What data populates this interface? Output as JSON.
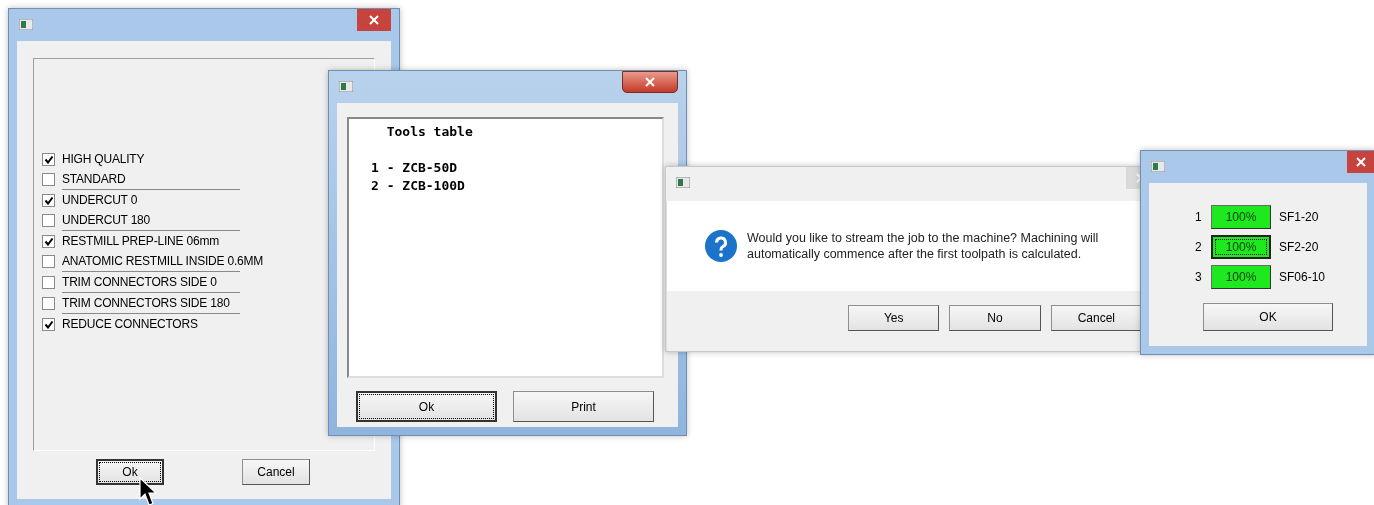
{
  "windows": [
    {
      "kind": "options",
      "items": [
        {
          "kind": "checkbox",
          "label": "HIGH QUALITY",
          "checked": true
        },
        {
          "kind": "checkbox",
          "label": "STANDARD",
          "checked": false
        },
        {
          "kind": "divider"
        },
        {
          "kind": "checkbox",
          "label": "UNDERCUT 0",
          "checked": true
        },
        {
          "kind": "checkbox",
          "label": "UNDERCUT 180",
          "checked": false
        },
        {
          "kind": "divider"
        },
        {
          "kind": "checkbox",
          "label": "RESTMILL PREP-LINE 06mm",
          "checked": true
        },
        {
          "kind": "checkbox",
          "label": "ANATOMIC RESTMILL INSIDE 0.6MM",
          "checked": false
        },
        {
          "kind": "divider"
        },
        {
          "kind": "checkbox",
          "label": "TRIM CONNECTORS SIDE 0",
          "checked": false
        },
        {
          "kind": "divider"
        },
        {
          "kind": "checkbox",
          "label": "TRIM CONNECTORS SIDE 180",
          "checked": false
        },
        {
          "kind": "divider"
        },
        {
          "kind": "checkbox",
          "label": "REDUCE CONNECTORS",
          "checked": true
        }
      ],
      "buttons": [
        {
          "label": "Ok",
          "focused": true
        },
        {
          "label": "Cancel",
          "focused": false
        }
      ]
    },
    {
      "kind": "text_list",
      "heading": "Tools table",
      "lines": [
        "1 - ZCB-50D",
        "2 - ZCB-100D"
      ],
      "buttons": [
        {
          "label": "Ok",
          "focused": true
        },
        {
          "label": "Print",
          "focused": false
        }
      ]
    },
    {
      "kind": "message",
      "message": "Would you like to stream the job to the machine? Machining will automatically commence after the first toolpath is calculated.",
      "buttons": [
        {
          "label": "Yes",
          "focused": false
        },
        {
          "label": "No",
          "focused": false
        },
        {
          "label": "Cancel",
          "focused": false
        }
      ]
    },
    {
      "kind": "levels",
      "rows": [
        {
          "number": "1",
          "value": "100%",
          "name": "SF1-20",
          "focused": false
        },
        {
          "number": "2",
          "value": "100%",
          "name": "SF2-20",
          "focused": true
        },
        {
          "number": "3",
          "value": "100%",
          "name": "SF06-10",
          "focused": false
        }
      ],
      "buttons": [
        {
          "label": "OK",
          "focused": false
        }
      ]
    }
  ]
}
